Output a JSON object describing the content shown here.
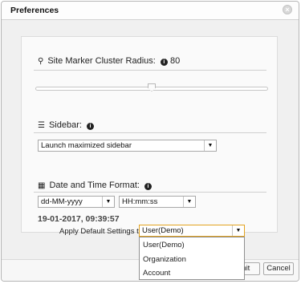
{
  "dialog": {
    "title": "Preferences",
    "close_symbol": "×",
    "close_icon": "close-circle-icon"
  },
  "cluster": {
    "label": "Site Marker Cluster Radius:",
    "icon": "map-marker-icon",
    "icon_glyph": "⚲",
    "info_icon": "info-circle-icon",
    "info_glyph": "i",
    "value": "80",
    "slider_fraction": 0.5
  },
  "sidebar": {
    "label": "Sidebar:",
    "icon": "hamburger-menu-icon",
    "icon_glyph": "☰",
    "info_glyph": "i",
    "selected": "Launch maximized sidebar"
  },
  "datetime": {
    "label": "Date and Time Format:",
    "icon": "calendar-icon",
    "icon_glyph": "▦",
    "info_glyph": "i",
    "date_format": "dd-MM-yyyy",
    "time_format": "HH:mm:ss",
    "preview": "19-01-2017, 09:39:57"
  },
  "apply": {
    "label": "Apply Default Settings to:",
    "selected": "User(Demo)",
    "options": [
      "User(Demo)",
      "Organization",
      "Account"
    ]
  },
  "buttons": {
    "submit_visible": "mit",
    "cancel": "Cancel"
  },
  "symbols": {
    "dropdown_arrow": "▼"
  }
}
